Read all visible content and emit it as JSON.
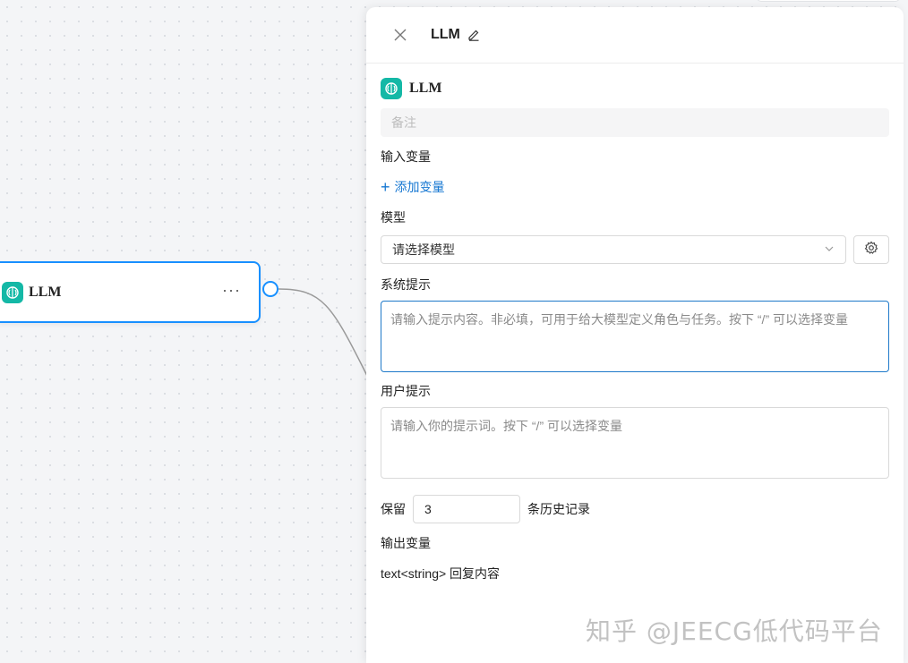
{
  "node": {
    "title": "LLM",
    "more": "···"
  },
  "panel": {
    "title": "LLM",
    "node_type": "LLM",
    "remark_placeholder": "备注",
    "input_vars_label": "输入变量",
    "add_var_label": "添加变量",
    "model_label": "模型",
    "model_placeholder": "请选择模型",
    "system_prompt_label": "系统提示",
    "system_prompt_placeholder": "请输入提示内容。非必填，可用于给大模型定义角色与任务。按下 “/” 可以选择变量",
    "user_prompt_label": "用户提示",
    "user_prompt_placeholder": "请输入你的提示词。按下 “/” 可以选择变量",
    "keep_label": "保留",
    "keep_value": "3",
    "history_label": "条历史记录",
    "output_vars_label": "输出变量",
    "output_var": "text<string> 回复内容"
  },
  "watermark": "知乎 @JEECG低代码平台",
  "colors": {
    "accent": "#1890ff",
    "link": "#1677d2",
    "llm_icon": "#14b8a6"
  },
  "icons": [
    "brain-icon",
    "close-icon",
    "edit-icon",
    "plus-icon",
    "chevron-down-icon",
    "gear-icon"
  ]
}
